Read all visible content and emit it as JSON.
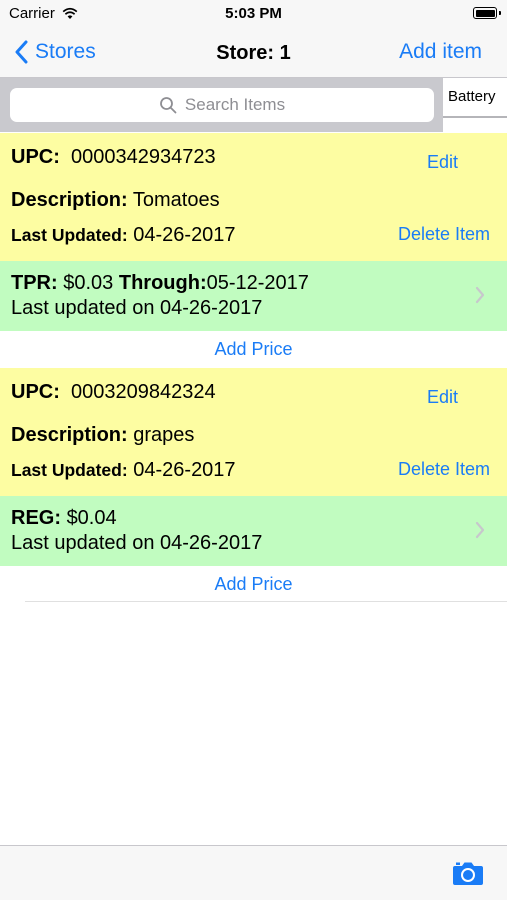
{
  "status_bar": {
    "carrier": "Carrier",
    "time": "5:03 PM"
  },
  "nav": {
    "back_label": "Stores",
    "title": "Store: 1",
    "add_item_label": "Add item"
  },
  "search": {
    "placeholder": "Search Items",
    "scope_tab": "Battery"
  },
  "items": [
    {
      "upc_label": "UPC:",
      "upc": "0000342934723",
      "desc_label": "Description:",
      "description": "Tomatoes",
      "updated_label": "Last Updated:",
      "updated": "04-26-2017",
      "edit_label": "Edit",
      "delete_label": "Delete Item",
      "price": {
        "type_label": "TPR:",
        "value": "$0.03",
        "through_label": "Through:",
        "through": "05-12-2017",
        "updated_text": "Last updated on 04-26-2017"
      },
      "add_price_label": "Add Price"
    },
    {
      "upc_label": "UPC:",
      "upc": "0003209842324",
      "desc_label": "Description:",
      "description": "grapes",
      "updated_label": "Last Updated:",
      "updated": "04-26-2017",
      "edit_label": "Edit",
      "delete_label": "Delete Item",
      "price": {
        "type_label": "REG:",
        "value": "$0.04",
        "updated_text": "Last updated on 04-26-2017"
      },
      "add_price_label": "Add Price"
    }
  ],
  "colors": {
    "accent": "#1a7cf6",
    "item_bg": "#fdfda2",
    "price_bg": "#c1fcc0"
  },
  "toolbar": {
    "icon": "camera-icon"
  }
}
